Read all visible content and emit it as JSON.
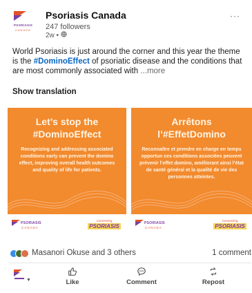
{
  "post": {
    "author": {
      "name": "Psoriasis Canada",
      "followers": "247 followers",
      "time": "2w • ",
      "logo_text_top": "PSORIASIS",
      "logo_text_bottom": "CANADA"
    },
    "text_before": "World Psoriasis is just around the corner and this year the theme is the ",
    "hashtag": "#DominoEffect",
    "text_after": " of psoriatic disease and the conditions that are most commonly associated with ",
    "more_label": "...more",
    "show_translation": "Show translation"
  },
  "banner": {
    "left": {
      "title_line1": "Let’s stop the",
      "title_line2": "#DominoEffect",
      "body": "Recognizing and addressing associated conditions early can prevent the domino effect, improving overall health outcomes and quality of life for patients."
    },
    "right": {
      "title_line1": "Arrêtons",
      "title_line2": "l’#EffetDomino",
      "body": "Reconnaître et prendre en charge en temps opportun ces conditions associées peuvent prévenir l’effet domino, améliorant ainsi l’état de santé général et la qualité de vie des personnes atteintes."
    },
    "footer_logo_top": "PSORIASIS",
    "footer_logo_bottom": "CANADA",
    "badge_top": "Connecting",
    "badge_bottom": "PSORIASIS"
  },
  "social": {
    "reactions": "Masanori Okuse and 3 others",
    "comments": "1 comment"
  },
  "actions": {
    "like": "Like",
    "comment": "Comment",
    "repost": "Repost"
  },
  "icons": {
    "more": "more-options-icon",
    "globe": "globe-icon",
    "like": "thumbs-up-icon",
    "comment": "comment-icon",
    "repost": "repost-icon"
  },
  "colors": {
    "brand_orange": "#f28a2e",
    "brand_purple": "#7b3fa0",
    "brand_red": "#e2532a",
    "link_blue": "#0a66c2"
  }
}
